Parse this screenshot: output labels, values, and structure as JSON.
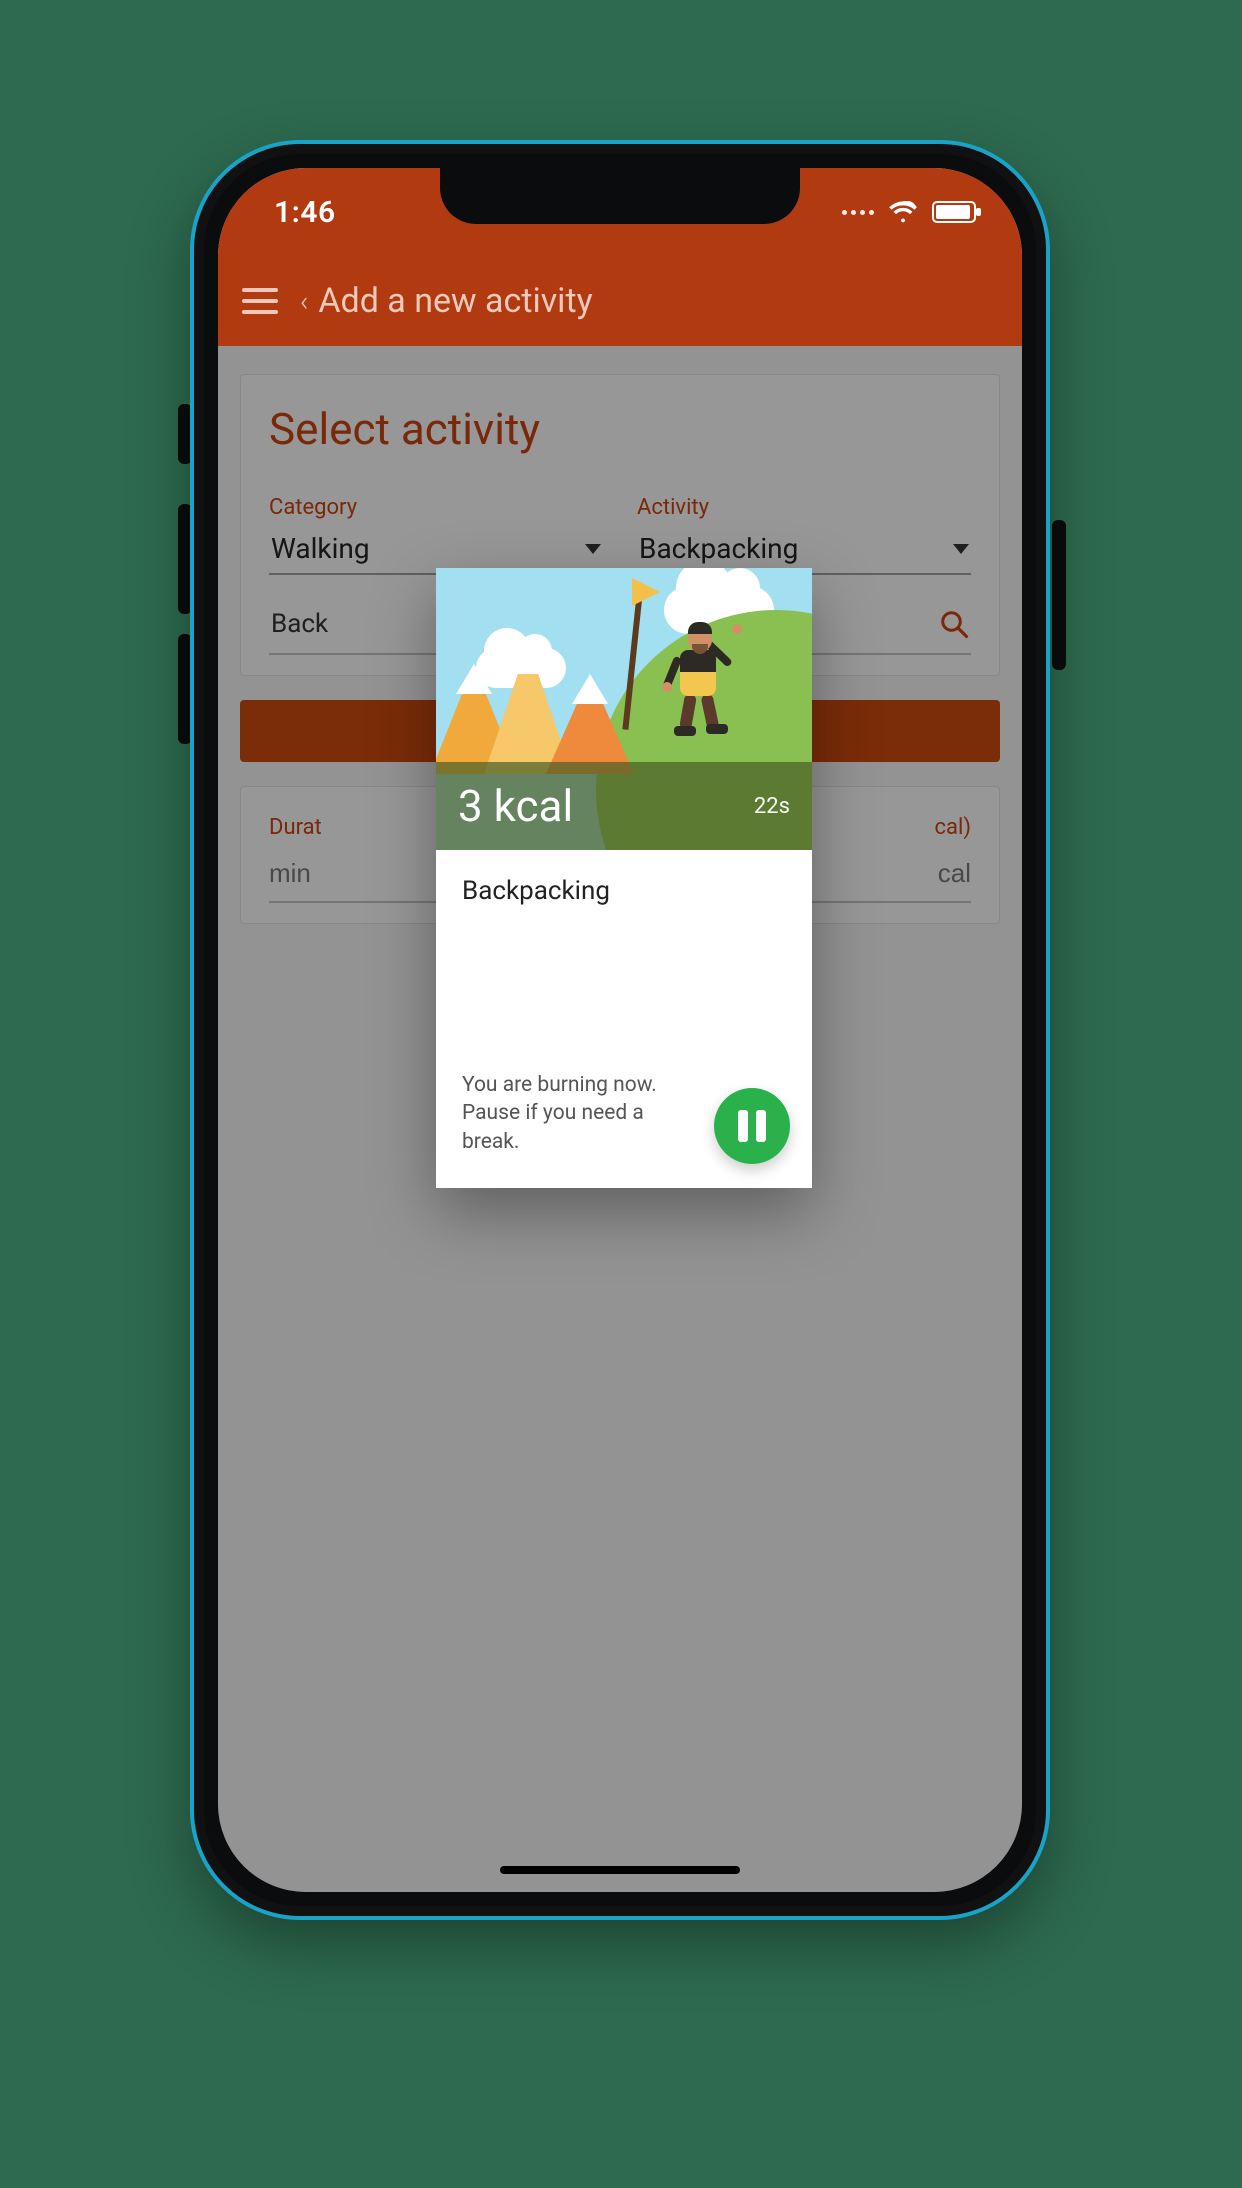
{
  "status": {
    "time": "1:46"
  },
  "header": {
    "back_label": "Add a new activity"
  },
  "page": {
    "title": "Select activity",
    "categoryLabel": "Category",
    "categoryValue": "Walking",
    "activityLabel": "Activity",
    "activityValue": "Backpacking",
    "searchValuePrefix": "Back",
    "durationLabel": "Durat",
    "durationPlaceholder": "min",
    "energyLabelSuffix": "cal)",
    "energyPlaceholder": "cal"
  },
  "modal": {
    "kcal": "3 kcal",
    "time": "22s",
    "activityName": "Backpacking",
    "hint": "You are burning now. Pause if you need a break."
  }
}
